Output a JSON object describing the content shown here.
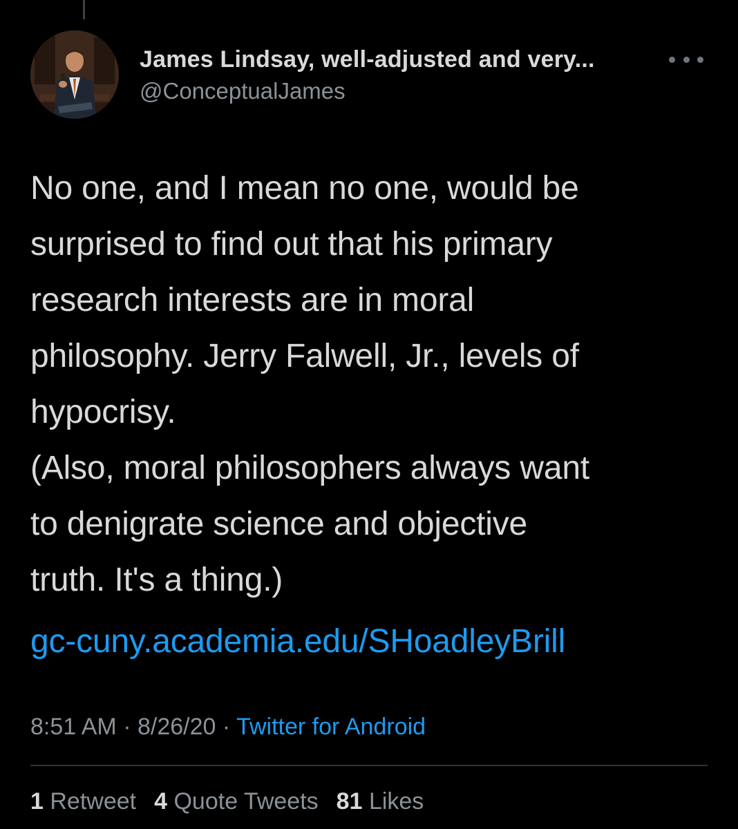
{
  "tweet": {
    "author": {
      "display_name": "James Lindsay, well-adjusted and very...",
      "handle": "@ConceptualJames"
    },
    "text": "No one, and I mean no one, would be\nsurprised to find out that his primary\nresearch interests are in moral\nphilosophy. Jerry Falwell, Jr., levels of\nhypocrisy.\n(Also, moral philosophers always want\nto denigrate science and objective\ntruth. It's a thing.)",
    "link": "gc-cuny.academia.edu/SHoadleyBrill",
    "time": "8:51 AM",
    "date": "8/26/20",
    "separator": "·",
    "source": "Twitter for Android",
    "stats": {
      "retweets": {
        "count": "1",
        "label": "Retweet"
      },
      "quotes": {
        "count": "4",
        "label": "Quote Tweets"
      },
      "likes": {
        "count": "81",
        "label": "Likes"
      }
    }
  },
  "colors": {
    "background": "#000000",
    "text": "#d9d9d9",
    "secondary": "#8b9298",
    "link": "#1d9bf0",
    "divider": "#2f3336"
  },
  "icons": {
    "more": "more-horizontal-icon"
  }
}
